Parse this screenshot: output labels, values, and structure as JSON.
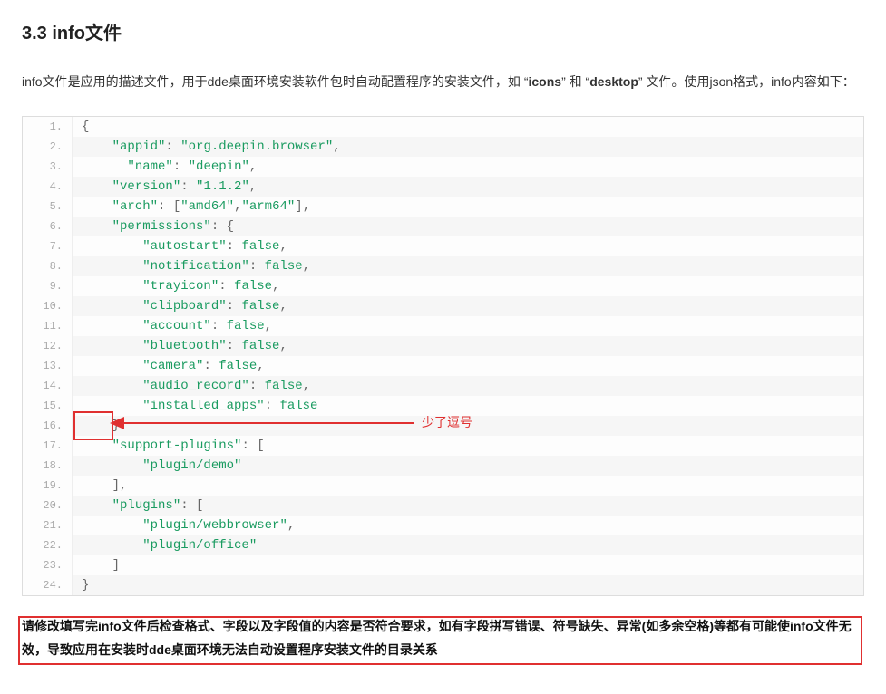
{
  "section_title": "3.3 info文件",
  "intro": {
    "t1": "info文件是应用的描述文件，用于dde桌面环境安装软件包时自动配置程序的安装文件，如",
    "q1a": "“",
    "b1": "icons",
    "q1b": "”",
    "t2": "和",
    "q2a": "“",
    "b2": "desktop",
    "q2b": "”",
    "t3": "文件。使用json格式，info内容如下：",
    "line2": ""
  },
  "code": [
    {
      "n": "1.",
      "raw": "{"
    },
    {
      "n": "2.",
      "raw": "    \"appid\": \"org.deepin.browser\","
    },
    {
      "n": "3.",
      "raw": "      \"name\": \"deepin\","
    },
    {
      "n": "4.",
      "raw": "    \"version\": \"1.1.2\","
    },
    {
      "n": "5.",
      "raw": "    \"arch\": [\"amd64\",\"arm64\"],"
    },
    {
      "n": "6.",
      "raw": "    \"permissions\": {"
    },
    {
      "n": "7.",
      "raw": "        \"autostart\": false,"
    },
    {
      "n": "8.",
      "raw": "        \"notification\": false,"
    },
    {
      "n": "9.",
      "raw": "        \"trayicon\": false,"
    },
    {
      "n": "10.",
      "raw": "        \"clipboard\": false,"
    },
    {
      "n": "11.",
      "raw": "        \"account\": false,"
    },
    {
      "n": "12.",
      "raw": "        \"bluetooth\": false,"
    },
    {
      "n": "13.",
      "raw": "        \"camera\": false,"
    },
    {
      "n": "14.",
      "raw": "        \"audio_record\": false,"
    },
    {
      "n": "15.",
      "raw": "        \"installed_apps\": false"
    },
    {
      "n": "16.",
      "raw": "    }"
    },
    {
      "n": "17.",
      "raw": "    \"support-plugins\": ["
    },
    {
      "n": "18.",
      "raw": "        \"plugin/demo\""
    },
    {
      "n": "19.",
      "raw": "    ],"
    },
    {
      "n": "20.",
      "raw": "    \"plugins\": ["
    },
    {
      "n": "21.",
      "raw": "        \"plugin/webbrowser\","
    },
    {
      "n": "22.",
      "raw": "        \"plugin/office\""
    },
    {
      "n": "23.",
      "raw": "    ]"
    },
    {
      "n": "24.",
      "raw": "}"
    }
  ],
  "annotation_label": "少了逗号",
  "footer": {
    "p1": "请修改填写完info文件后检查格式、字段以及字段值的内容是否符合要求，",
    "p2": "如有字段拼写错误、符号缺失、异常(如多余空格)等都有可能使info文件无效，导致应用在安装时dde桌面环境无法自动设置程序安装文件的目录关系"
  }
}
